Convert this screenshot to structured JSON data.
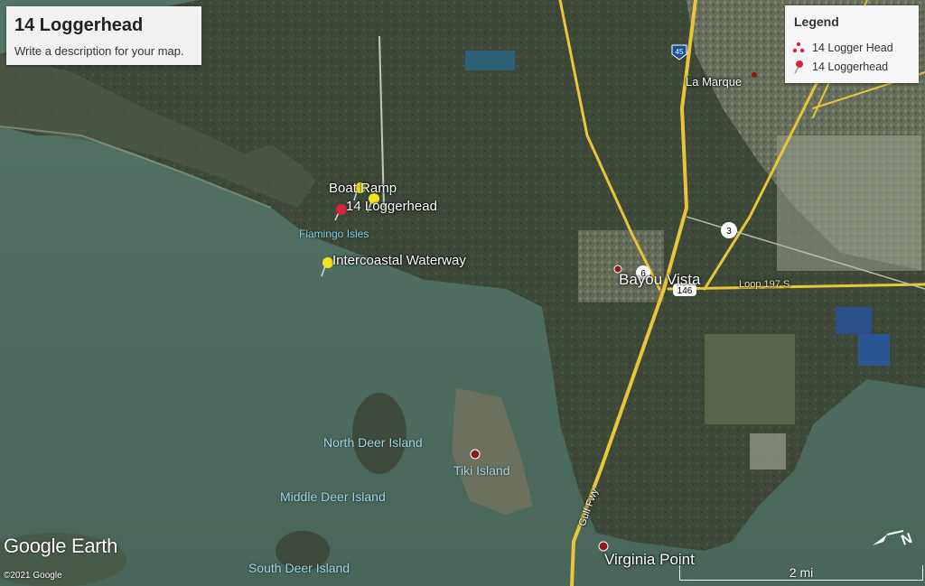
{
  "title_panel": {
    "title": "14 Loggerhead",
    "description": "Write a description for your map."
  },
  "legend": {
    "heading": "Legend",
    "items": [
      {
        "label": "14 Logger Head",
        "icon": "polygon-marker-icon"
      },
      {
        "label": "14 Loggerhead",
        "icon": "red-pushpin-icon"
      }
    ]
  },
  "places": {
    "boat_ramp": "Boat Ramp",
    "loggerhead": "14 Loggerhead",
    "flamingo_isles": "Flamingo Isles",
    "intercoastal": "Intercoastal Waterway",
    "la_marque": "La Marque",
    "bayou_vista": "Bayou Vista",
    "north_deer": "North Deer Island",
    "tiki": "Tiki Island",
    "middle_deer": "Middle Deer Island",
    "south_deer": "South Deer Island",
    "virginia_point": "Virginia Point",
    "gulf_fwy": "Gulf Fwy",
    "loop": "Loop 197 S"
  },
  "shields": {
    "i45": "45",
    "us3": "3",
    "us6": "6",
    "sh146": "146"
  },
  "footer": {
    "logo": "Google Earth",
    "copyright": "©2021 Google",
    "scale": "2 mi"
  },
  "colors": {
    "water": "#4d6b60",
    "land": "#3f4a3c",
    "road": "#e8c53a",
    "pin_yellow": "#f4e21f",
    "pin_red": "#d8243a"
  }
}
